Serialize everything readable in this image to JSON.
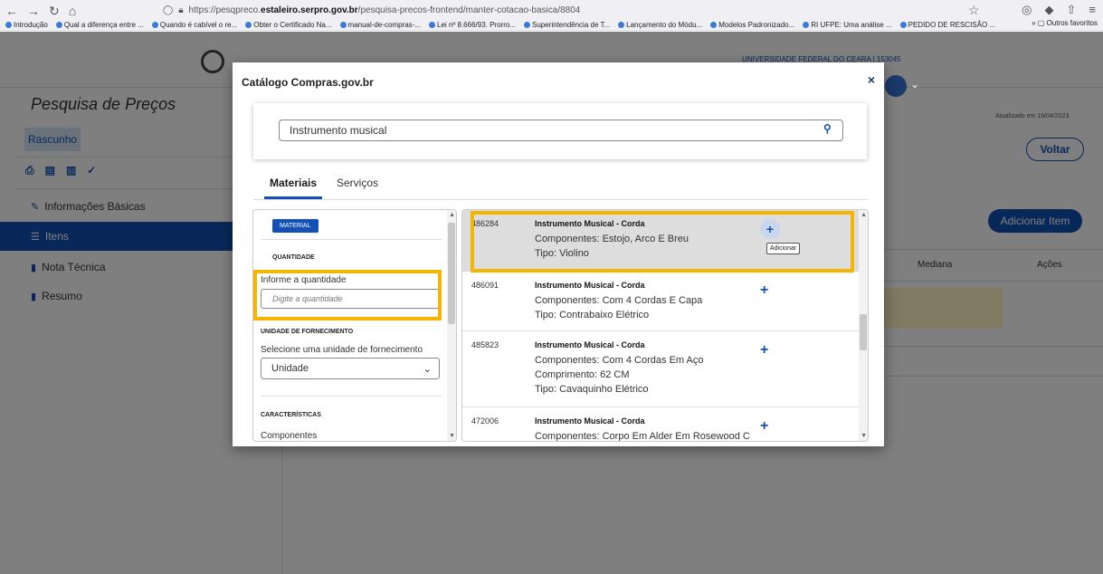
{
  "browser": {
    "url_prefix": "https://pesqpreco.",
    "url_host": "estaleiro.serpro.gov.br",
    "url_path": "/pesquisa-precos-frontend/manter-cotacao-basica/8804",
    "bookmarks": [
      "Introdução",
      "Qual a diferença entre ...",
      "Quando é cabível o re...",
      "Obter o Certificado Na...",
      "manual-de-compras-...",
      "Lei nº 8.666/93. Prorro...",
      "Superintendência de T...",
      "Lançamento do Módu...",
      "Modelos Padronizado...",
      "RI UFPE: Uma análise ...",
      "PEDIDO DE RESCISÃO ..."
    ],
    "bookmarks_more": "Outros favoritos"
  },
  "header": {
    "university": "UNIVERSIDADE FEDERAL DO CEARA | 153045"
  },
  "sidebar": {
    "title": "Pesquisa de Preços",
    "status": "Rascunho",
    "items": [
      {
        "label": "Informações Básicas",
        "icon": "pencil-icon"
      },
      {
        "label": "Itens",
        "icon": "list-icon"
      },
      {
        "label": "Nota Técnica",
        "icon": "file-icon"
      },
      {
        "label": "Resumo",
        "icon": "summary-icon"
      }
    ]
  },
  "main": {
    "updated": "Atualizado em 19/04/2023",
    "back_button": "Voltar",
    "add_item_button": "Adicionar Item",
    "columns": [
      "Mediana",
      "Ações"
    ]
  },
  "modal": {
    "title": "Catálogo Compras.gov.br",
    "search_value": "Instrumento musical",
    "tabs": [
      "Materiais",
      "Serviços"
    ],
    "filters": {
      "badge": "MATERIAL",
      "quantity_heading": "QUANTIDADE",
      "quantity_label": "Informe a quantidade",
      "quantity_placeholder": "Digite a quantidade",
      "unit_heading": "UNIDADE DE FORNECIMENTO",
      "unit_label": "Selecione uma unidade de fornecimento",
      "unit_value": "Unidade",
      "characteristics_heading": "CARACTERÍSTICAS",
      "components_label": "Componentes"
    },
    "results": [
      {
        "code": "486284",
        "title": "Instrumento Musical - Corda",
        "lines": [
          "Componentes: Estojo, Arco E Breu",
          "Tipo: Violino"
        ]
      },
      {
        "code": "486091",
        "title": "Instrumento Musical - Corda",
        "lines": [
          "Componentes: Com 4 Cordas E Capa",
          "Tipo: Contrabaixo Elétrico"
        ]
      },
      {
        "code": "485823",
        "title": "Instrumento Musical - Corda",
        "lines": [
          "Componentes: Com 4 Cordas Em Aço",
          "Comprimento: 62 CM",
          "Tipo: Cavaquinho Elétrico"
        ]
      },
      {
        "code": "472006",
        "title": "Instrumento Musical - Corda",
        "lines": [
          "Componentes: Corpo Em Alder Em Rosewood C"
        ]
      }
    ],
    "tooltip": "Adicionar"
  },
  "colors": {
    "primary": "#1351b4",
    "highlight": "#f5b400"
  }
}
